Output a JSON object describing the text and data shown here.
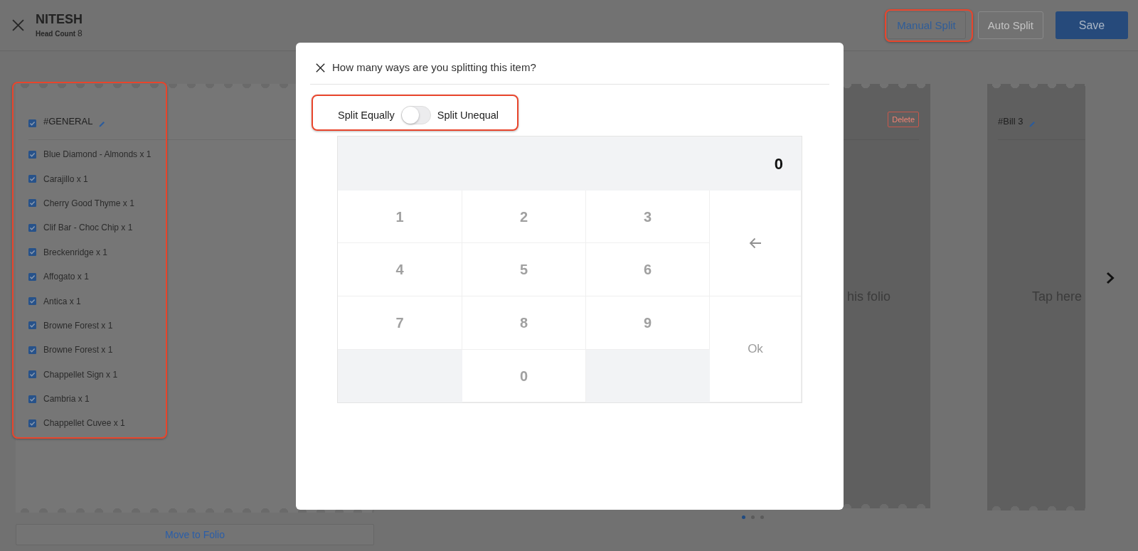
{
  "header": {
    "title": "NITESH",
    "head_count_label": "Head Count",
    "head_count": "8"
  },
  "split_modes": [
    {
      "label": "Manual Split",
      "selected": true,
      "highlighted": true
    },
    {
      "label": "Auto Split",
      "selected": false,
      "highlighted": false
    }
  ],
  "save_button": "Save",
  "folios": [
    {
      "kind": "list",
      "title": "#GENERAL",
      "checked": true,
      "highlighted": true,
      "items": [
        {
          "label": "Blue Diamond - Almonds x 1",
          "checked": true
        },
        {
          "label": "Carajillo x 1",
          "checked": true
        },
        {
          "label": "Cherry Good Thyme x 1",
          "checked": true
        },
        {
          "label": "Clif Bar - Choc Chip x 1",
          "checked": true
        },
        {
          "label": "Breckenridge x 1",
          "checked": true
        },
        {
          "label": "Affogato x 1",
          "checked": true
        },
        {
          "label": "Antica x 1",
          "checked": true
        },
        {
          "label": "Browne Forest x 1",
          "checked": true
        },
        {
          "label": "Browne Forest x 1",
          "checked": true
        },
        {
          "label": "Chappellet Sign x 1",
          "checked": true
        },
        {
          "label": "Cambria x 1",
          "checked": true
        },
        {
          "label": "Chappellet Cuvee x 1",
          "checked": true
        }
      ]
    },
    {
      "kind": "empty",
      "action": "Delete",
      "hint": "his folio"
    },
    {
      "kind": "empty",
      "title": "#Bill 3",
      "hint": "Tap here"
    }
  ],
  "pager": [
    {
      "selected": true
    },
    {
      "selected": false
    },
    {
      "selected": false
    }
  ],
  "move_button": "Move to Folio",
  "dialog": {
    "title": "How many ways are you splitting this item?",
    "split_toggle": {
      "left_label": "Split Equally",
      "right_label": "Split Unequal",
      "on": false,
      "highlighted": true
    },
    "display": "0",
    "keys": [
      {
        "kind": "digit",
        "label": "1"
      },
      {
        "kind": "digit",
        "label": "2"
      },
      {
        "kind": "digit",
        "label": "3"
      },
      {
        "kind": "backspace"
      },
      {
        "kind": "digit",
        "label": "4"
      },
      {
        "kind": "digit",
        "label": "5"
      },
      {
        "kind": "digit",
        "label": "6"
      },
      {
        "kind": "digit",
        "label": "7"
      },
      {
        "kind": "digit",
        "label": "8"
      },
      {
        "kind": "digit",
        "label": "9"
      },
      {
        "kind": "ok",
        "label": "Ok",
        "disabled": true
      },
      {
        "kind": "digit",
        "label": "0"
      }
    ]
  }
}
